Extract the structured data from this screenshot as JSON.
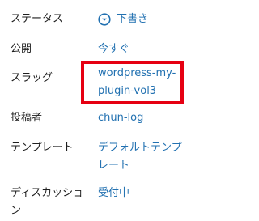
{
  "panel": {
    "rows": [
      {
        "label": "ステータス",
        "value": "下書き",
        "icon": "chevron-down-circle-icon"
      },
      {
        "label": "公開",
        "value": "今すぐ"
      },
      {
        "label": "スラッグ",
        "value_lines": [
          "wordpress-my-",
          "plugin-vol3"
        ]
      },
      {
        "label": "投稿者",
        "value": "chun-log"
      },
      {
        "label": "テンプレート",
        "value_lines": [
          "デフォルトテンプ",
          "レート"
        ]
      },
      {
        "label_lines": [
          "ディスカッショ",
          "ン"
        ],
        "value": "受付中"
      }
    ]
  },
  "colors": {
    "link": "#2271b1",
    "label": "#1e1e1e",
    "highlight": "#e60012"
  }
}
